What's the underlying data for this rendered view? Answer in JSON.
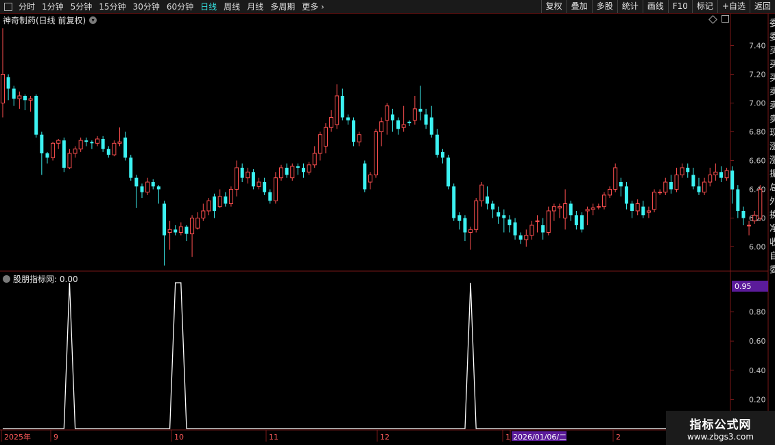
{
  "toolbar": {
    "periods": [
      "分时",
      "1分钟",
      "5分钟",
      "15分钟",
      "30分钟",
      "60分钟",
      "日线",
      "周线",
      "月线",
      "多周期",
      "更多"
    ],
    "active": "日线",
    "buttons": [
      "复权",
      "叠加",
      "多股",
      "统计",
      "画线",
      "F10",
      "标记",
      "+自选",
      "返回"
    ]
  },
  "main_chart": {
    "title": "神奇制药(日线 前复权)"
  },
  "indicator": {
    "title": "股朋指标网",
    "value": ": 0.00",
    "current_label": "0.95"
  },
  "time_axis": {
    "labels": [
      "2025年",
      "9",
      "10",
      "11",
      "12",
      "1",
      "2026/01/06/二",
      "2"
    ]
  },
  "right_strip_chars": [
    "委",
    "委",
    "买",
    "买",
    "买",
    "卖",
    "卖",
    "卖",
    "现",
    "涨",
    "涨",
    "振",
    "总",
    "外",
    "换",
    "净",
    "收",
    "自",
    "委"
  ],
  "watermark": {
    "line1": "指标公式网",
    "line2": "www.zbgs3.com"
  },
  "colors": {
    "up": "#ff4f4f",
    "down": "#3cf2f2",
    "bg": "#000000",
    "frame": "#7a1818",
    "indicator": "#ffffff",
    "axis_text": "#c8c8c8",
    "label_bg": "#5b1b9a"
  },
  "chart_data": [
    {
      "type": "candlestick",
      "title": "神奇制药(日线 前复权)",
      "ylim": [
        5.85,
        7.55
      ],
      "yticks": [
        6.0,
        6.2,
        6.4,
        6.6,
        6.8,
        7.0,
        7.2,
        7.4
      ],
      "candles": [
        [
          7.0,
          7.2,
          7.52,
          6.9
        ],
        [
          7.18,
          7.1,
          7.2,
          7.02
        ],
        [
          7.1,
          7.03,
          7.12,
          6.98
        ],
        [
          7.03,
          7.05,
          7.08,
          6.96
        ],
        [
          7.05,
          7.02,
          7.06,
          6.95
        ],
        [
          7.02,
          7.03,
          7.05,
          6.94
        ],
        [
          7.05,
          6.78,
          7.06,
          6.76
        ],
        [
          6.78,
          6.65,
          6.8,
          6.5
        ],
        [
          6.65,
          6.62,
          6.66,
          6.58
        ],
        [
          6.62,
          6.72,
          6.73,
          6.6
        ],
        [
          6.72,
          6.74,
          6.75,
          6.68
        ],
        [
          6.74,
          6.55,
          6.76,
          6.52
        ],
        [
          6.55,
          6.65,
          6.68,
          6.54
        ],
        [
          6.65,
          6.68,
          6.7,
          6.62
        ],
        [
          6.68,
          6.74,
          6.76,
          6.66
        ],
        [
          6.74,
          6.73,
          6.76,
          6.7
        ],
        [
          6.73,
          6.72,
          6.74,
          6.68
        ],
        [
          6.72,
          6.75,
          6.77,
          6.7
        ],
        [
          6.75,
          6.68,
          6.77,
          6.66
        ],
        [
          6.68,
          6.64,
          6.7,
          6.62
        ],
        [
          6.64,
          6.72,
          6.74,
          6.63
        ],
        [
          6.72,
          6.73,
          6.83,
          6.7
        ],
        [
          6.76,
          6.62,
          6.8,
          6.6
        ],
        [
          6.62,
          6.48,
          6.64,
          6.46
        ],
        [
          6.48,
          6.42,
          6.5,
          6.27
        ],
        [
          6.42,
          6.38,
          6.44,
          6.34
        ],
        [
          6.38,
          6.45,
          6.48,
          6.36
        ],
        [
          6.45,
          6.42,
          6.47,
          6.4
        ],
        [
          6.42,
          6.4,
          6.43,
          6.3
        ],
        [
          6.3,
          6.08,
          6.32,
          5.87
        ],
        [
          6.1,
          6.12,
          6.18,
          5.98
        ],
        [
          6.12,
          6.1,
          6.15,
          6.08
        ],
        [
          6.1,
          6.14,
          6.17,
          6.08
        ],
        [
          6.14,
          6.09,
          6.15,
          6.04
        ],
        [
          6.09,
          6.2,
          6.22,
          5.93
        ],
        [
          6.13,
          6.2,
          6.24,
          6.12
        ],
        [
          6.2,
          6.25,
          6.3,
          6.18
        ],
        [
          6.25,
          6.32,
          6.34,
          6.22
        ],
        [
          6.35,
          6.25,
          6.37,
          6.2
        ],
        [
          6.28,
          6.35,
          6.4,
          6.27
        ],
        [
          6.35,
          6.3,
          6.38,
          6.28
        ],
        [
          6.3,
          6.4,
          6.42,
          6.28
        ],
        [
          6.4,
          6.55,
          6.6,
          6.35
        ],
        [
          6.55,
          6.48,
          6.58,
          6.45
        ],
        [
          6.48,
          6.52,
          6.55,
          6.44
        ],
        [
          6.52,
          6.42,
          6.54,
          6.4
        ],
        [
          6.42,
          6.45,
          6.48,
          6.4
        ],
        [
          6.45,
          6.38,
          6.48,
          6.36
        ],
        [
          6.38,
          6.32,
          6.4,
          6.3
        ],
        [
          6.32,
          6.48,
          6.52,
          6.3
        ],
        [
          6.48,
          6.55,
          6.57,
          6.46
        ],
        [
          6.55,
          6.5,
          6.58,
          6.48
        ],
        [
          6.48,
          6.56,
          6.58,
          6.46
        ],
        [
          6.56,
          6.55,
          6.58,
          6.5
        ],
        [
          6.55,
          6.52,
          6.58,
          6.48
        ],
        [
          6.52,
          6.57,
          6.59,
          6.5
        ],
        [
          6.57,
          6.65,
          6.7,
          6.55
        ],
        [
          6.65,
          6.78,
          6.8,
          6.6
        ],
        [
          6.7,
          6.83,
          6.86,
          6.65
        ],
        [
          6.83,
          6.9,
          6.95,
          6.8
        ],
        [
          6.85,
          7.05,
          7.13,
          6.82
        ],
        [
          7.05,
          6.9,
          7.1,
          6.88
        ],
        [
          6.9,
          6.88,
          6.92,
          6.85
        ],
        [
          6.88,
          6.73,
          6.9,
          6.7
        ],
        [
          6.73,
          6.78,
          6.8,
          6.7
        ],
        [
          6.58,
          6.4,
          6.6,
          6.38
        ],
        [
          6.45,
          6.5,
          6.52,
          6.4
        ],
        [
          6.5,
          6.8,
          6.82,
          6.48
        ],
        [
          6.8,
          6.87,
          6.9,
          6.7
        ],
        [
          6.88,
          6.98,
          7.0,
          6.78
        ],
        [
          6.92,
          6.88,
          6.96,
          6.8
        ],
        [
          6.88,
          6.82,
          6.9,
          6.78
        ],
        [
          6.83,
          6.85,
          6.98,
          6.8
        ],
        [
          6.87,
          6.86,
          6.88,
          6.84
        ],
        [
          6.88,
          6.96,
          7.05,
          6.85
        ],
        [
          6.96,
          6.94,
          7.12,
          6.88
        ],
        [
          6.92,
          6.85,
          6.96,
          6.82
        ],
        [
          6.9,
          6.78,
          6.98,
          6.76
        ],
        [
          6.78,
          6.64,
          6.82,
          6.62
        ],
        [
          6.66,
          6.62,
          6.68,
          6.58
        ],
        [
          6.62,
          6.42,
          6.64,
          6.4
        ],
        [
          6.42,
          6.2,
          6.44,
          6.18
        ],
        [
          6.22,
          6.18,
          6.24,
          6.12
        ],
        [
          6.2,
          6.1,
          6.22,
          6.04
        ],
        [
          6.1,
          6.12,
          6.14,
          5.98
        ],
        [
          6.12,
          6.32,
          6.34,
          6.1
        ],
        [
          6.32,
          6.43,
          6.45,
          6.28
        ],
        [
          6.35,
          6.3,
          6.42,
          6.26
        ],
        [
          6.3,
          6.26,
          6.32,
          6.2
        ],
        [
          6.24,
          6.21,
          6.28,
          6.16
        ],
        [
          6.22,
          6.2,
          6.26,
          6.1
        ],
        [
          6.19,
          6.15,
          6.22,
          6.1
        ],
        [
          6.17,
          6.08,
          6.2,
          6.05
        ],
        [
          6.08,
          6.05,
          6.1,
          6.02
        ],
        [
          6.05,
          6.08,
          6.12,
          6.0
        ],
        [
          6.08,
          6.15,
          6.18,
          6.05
        ],
        [
          6.18,
          6.18,
          6.22,
          6.1
        ],
        [
          6.15,
          6.1,
          6.2,
          6.05
        ],
        [
          6.1,
          6.25,
          6.28,
          6.08
        ],
        [
          6.25,
          6.28,
          6.3,
          6.18
        ],
        [
          6.27,
          6.28,
          6.3,
          6.2
        ],
        [
          6.2,
          6.3,
          6.4,
          6.12
        ],
        [
          6.3,
          6.22,
          6.32,
          6.18
        ],
        [
          6.22,
          6.15,
          6.25,
          6.12
        ],
        [
          6.22,
          6.12,
          6.24,
          6.1
        ],
        [
          6.25,
          6.26,
          6.28,
          6.15
        ],
        [
          6.26,
          6.27,
          6.3,
          6.22
        ],
        [
          6.28,
          6.28,
          6.3,
          6.26
        ],
        [
          6.28,
          6.36,
          6.38,
          6.26
        ],
        [
          6.36,
          6.4,
          6.42,
          6.34
        ],
        [
          6.4,
          6.55,
          6.58,
          6.38
        ],
        [
          6.45,
          6.42,
          6.48,
          6.35
        ],
        [
          6.42,
          6.3,
          6.45,
          6.26
        ],
        [
          6.3,
          6.25,
          6.32,
          6.2
        ],
        [
          6.25,
          6.3,
          6.33,
          6.22
        ],
        [
          6.28,
          6.22,
          6.32,
          6.2
        ],
        [
          6.24,
          6.25,
          6.28,
          6.2
        ],
        [
          6.26,
          6.38,
          6.4,
          6.24
        ],
        [
          6.38,
          6.38,
          6.4,
          6.36
        ],
        [
          6.38,
          6.45,
          6.48,
          6.36
        ],
        [
          6.45,
          6.4,
          6.5,
          6.37
        ],
        [
          6.4,
          6.5,
          6.55,
          6.38
        ],
        [
          6.5,
          6.55,
          6.58,
          6.48
        ],
        [
          6.55,
          6.52,
          6.58,
          6.48
        ],
        [
          6.5,
          6.42,
          6.55,
          6.4
        ],
        [
          6.42,
          6.38,
          6.48,
          6.36
        ],
        [
          6.38,
          6.45,
          6.48,
          6.36
        ],
        [
          6.45,
          6.5,
          6.55,
          6.42
        ],
        [
          6.5,
          6.52,
          6.58,
          6.46
        ],
        [
          6.52,
          6.48,
          6.56,
          6.45
        ],
        [
          6.48,
          6.53,
          6.55,
          6.46
        ],
        [
          6.53,
          6.4,
          6.56,
          6.3
        ],
        [
          6.4,
          6.25,
          6.43,
          6.2
        ],
        [
          6.25,
          6.2,
          6.28,
          6.15
        ],
        [
          6.15,
          6.15,
          6.18,
          6.08
        ],
        [
          6.18,
          6.22,
          6.25,
          6.16
        ],
        [
          6.2,
          6.4,
          6.43,
          6.18
        ]
      ]
    },
    {
      "type": "line",
      "title": "股朋指标网",
      "ylim": [
        0,
        1
      ],
      "yticks": [
        0.2,
        0.4,
        0.6,
        0.8
      ],
      "series": [
        {
          "name": "股朋指标网",
          "peaks": [
            12,
            31,
            32,
            84
          ]
        }
      ]
    }
  ]
}
